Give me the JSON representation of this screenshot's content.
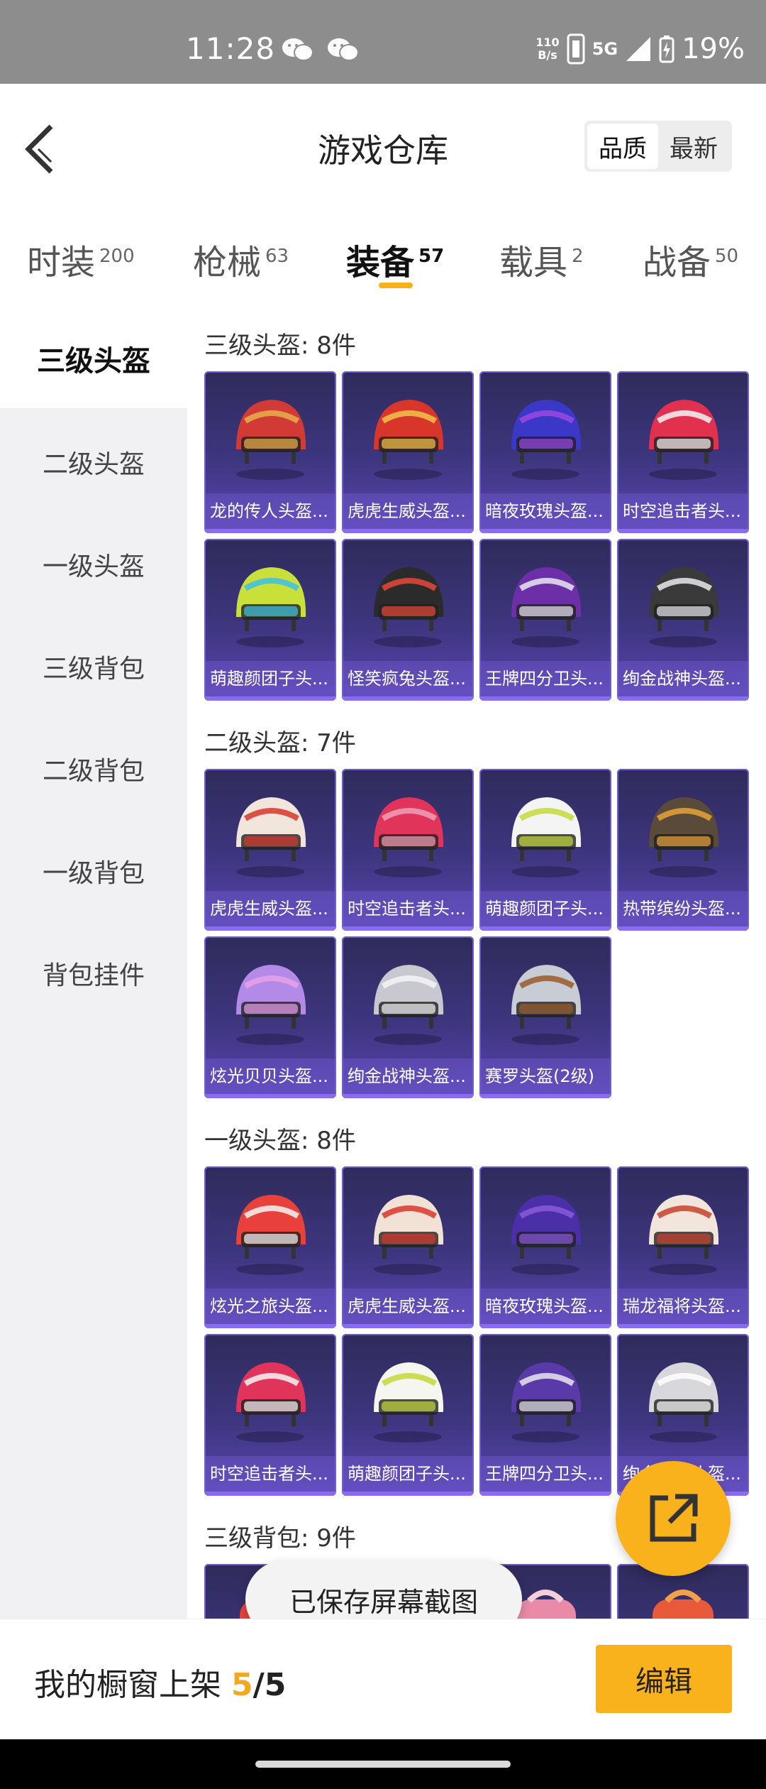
{
  "status_bar": {
    "time": "11:28",
    "net_speed_value": "110",
    "net_speed_unit": "B/s",
    "network": "5G",
    "battery": "19%"
  },
  "header": {
    "title": "游戏仓库",
    "sort_options": [
      "品质",
      "最新"
    ],
    "sort_active": "品质"
  },
  "tabs": [
    {
      "label": "时装",
      "count": "200"
    },
    {
      "label": "枪械",
      "count": "63"
    },
    {
      "label": "装备",
      "count": "57",
      "active": true
    },
    {
      "label": "载具",
      "count": "2"
    },
    {
      "label": "战备",
      "count": "50"
    }
  ],
  "sidebar": {
    "items": [
      "三级头盔",
      "二级头盔",
      "一级头盔",
      "三级背包",
      "二级背包",
      "一级背包",
      "背包挂件"
    ],
    "active_index": 0
  },
  "sections": [
    {
      "title": "三级头盔: 8件",
      "items": [
        {
          "label": "龙的传人头盔...",
          "color": "#d23a35",
          "accent": "#e8b04a",
          "icon": "helmet-icon"
        },
        {
          "label": "虎虎生威头盔...",
          "color": "#d8362b",
          "accent": "#f2c34a",
          "icon": "helmet-icon"
        },
        {
          "label": "暗夜玫瑰头盔...",
          "color": "#3b37c7",
          "accent": "#9b49e0",
          "icon": "helmet-icon"
        },
        {
          "label": "时空追击者头...",
          "color": "#e2314f",
          "accent": "#f4f4f4",
          "icon": "helmet-icon"
        },
        {
          "label": "萌趣颜团子头...",
          "color": "#c9e03a",
          "accent": "#3cc0e8",
          "icon": "helmet-icon"
        },
        {
          "label": "怪笑疯兔头盔...",
          "color": "#2b2b2b",
          "accent": "#e8483a",
          "icon": "helmet-icon"
        },
        {
          "label": "王牌四分卫头...",
          "color": "#6d2fa8",
          "accent": "#e8e8f0",
          "icon": "helmet-icon"
        },
        {
          "label": "绚金战神头盔...",
          "color": "#3a3a3a",
          "accent": "#e9e9ef",
          "icon": "helmet-icon"
        }
      ]
    },
    {
      "title": "二级头盔: 7件",
      "items": [
        {
          "label": "虎虎生威头盔...",
          "color": "#f2e6dc",
          "accent": "#d8362b",
          "icon": "helmet-icon"
        },
        {
          "label": "时空追击者头...",
          "color": "#e0345a",
          "accent": "#f0a0b8",
          "icon": "helmet-icon"
        },
        {
          "label": "萌趣颜团子头...",
          "color": "#f4f4f4",
          "accent": "#c4d83a",
          "icon": "helmet-icon"
        },
        {
          "label": "热带缤纷头盔...",
          "color": "#5a4a3a",
          "accent": "#e8a33a",
          "icon": "helmet-icon"
        },
        {
          "label": "炫光贝贝头盔...",
          "color": "#b48ae8",
          "accent": "#e8a0e8",
          "icon": "helmet-icon"
        },
        {
          "label": "绚金战神头盔...",
          "color": "#c8c8d0",
          "accent": "#f4f4f8",
          "icon": "helmet-icon"
        },
        {
          "label": "赛罗头盔(2级)",
          "color": "#c8ccd4",
          "accent": "#9a5a2a",
          "icon": "helmet-icon"
        }
      ]
    },
    {
      "title": "一级头盔: 8件",
      "items": [
        {
          "label": "炫光之旅头盔...",
          "color": "#e8403a",
          "accent": "#f4f4f4",
          "icon": "helmet-icon"
        },
        {
          "label": "虎虎生威头盔...",
          "color": "#f2e2d6",
          "accent": "#d8362b",
          "icon": "helmet-icon"
        },
        {
          "label": "暗夜玫瑰头盔...",
          "color": "#4a2fa8",
          "accent": "#8a5ad8",
          "icon": "helmet-icon"
        },
        {
          "label": "瑞龙福将头盔...",
          "color": "#f2e6dc",
          "accent": "#c8402a",
          "icon": "helmet-icon"
        },
        {
          "label": "时空追击者头...",
          "color": "#e0345a",
          "accent": "#f6f6f6",
          "icon": "helmet-icon"
        },
        {
          "label": "萌趣颜团子头...",
          "color": "#f6f6f0",
          "accent": "#c4d83a",
          "icon": "helmet-icon"
        },
        {
          "label": "王牌四分卫头...",
          "color": "#5a3aa8",
          "accent": "#e8e8f0",
          "icon": "helmet-icon"
        },
        {
          "label": "绚金战神头盔...",
          "color": "#d8d8dc",
          "accent": "#ffffff",
          "icon": "helmet-icon"
        }
      ]
    },
    {
      "title": "三级背包: 9件",
      "items": [
        {
          "label": "",
          "color": "#e8403a",
          "accent": "#f4a0a0",
          "icon": "backpack-icon"
        },
        {
          "label": "",
          "color": "#3a3a6a",
          "accent": "#6a5ab0",
          "icon": "backpack-icon"
        },
        {
          "label": "",
          "color": "#e88aa8",
          "accent": "#f4d0d8",
          "icon": "backpack-icon"
        },
        {
          "label": "",
          "color": "#e85a3a",
          "accent": "#f4a04a",
          "icon": "backpack-icon"
        }
      ]
    }
  ],
  "fab": {
    "icon": "share-external-icon"
  },
  "toast": "已保存屏幕截图",
  "bottom_bar": {
    "label": "我的橱窗上架",
    "current": "5",
    "separator": "/",
    "total": "5",
    "edit_label": "编辑"
  }
}
